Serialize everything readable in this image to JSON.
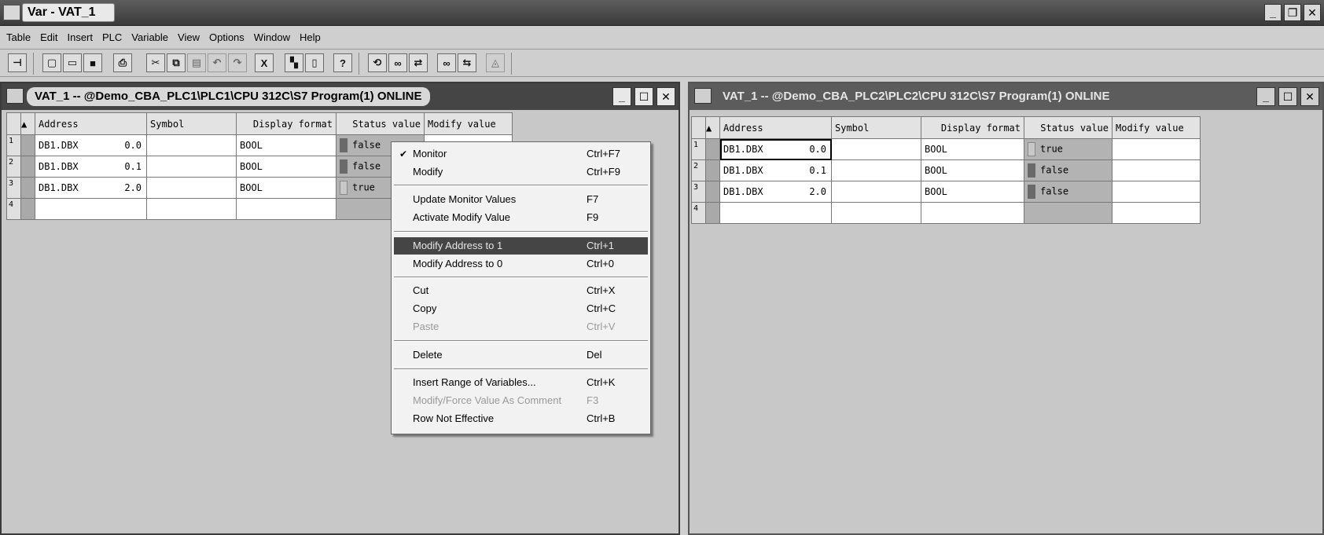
{
  "app": {
    "title": "Var - VAT_1",
    "window_buttons": [
      "_",
      "❐",
      "✕"
    ]
  },
  "menubar": [
    "Table",
    "Edit",
    "Insert",
    "PLC",
    "Variable",
    "View",
    "Options",
    "Window",
    "Help"
  ],
  "toolbar": {
    "glyphs": {
      "pin": "⊣",
      "new": "▢",
      "open": "▭",
      "save": "■",
      "print": "⎙",
      "cut": "✂",
      "copy": "⧉",
      "paste": "▤",
      "undo": "↶",
      "redo": "↷",
      "delete": "X",
      "online": "▚",
      "accessible": "▯",
      "help": "?",
      "monitor": "⟲",
      "monitor_var": "∞",
      "modify": "⇄",
      "update_monitor": "∞",
      "activate_modify": "⇆",
      "force": "◬"
    }
  },
  "left_window": {
    "title": "VAT_1 -- @Demo_CBA_PLC1\\PLC1\\CPU 312C\\S7 Program(1)  ONLINE",
    "headers": {
      "address": "Address",
      "symbol": "Symbol",
      "format": "Display format",
      "status": "Status value",
      "modify": "Modify value"
    },
    "rows": [
      {
        "num": "1",
        "addr": "DB1.DBX",
        "off": "0.0",
        "fmt": "BOOL",
        "status": "false",
        "led": "off"
      },
      {
        "num": "2",
        "addr": "DB1.DBX",
        "off": "0.1",
        "fmt": "BOOL",
        "status": "false",
        "led": "off"
      },
      {
        "num": "3",
        "addr": "DB1.DBX",
        "off": "2.0",
        "fmt": "BOOL",
        "status": "true",
        "led": "on"
      },
      {
        "num": "4",
        "addr": "",
        "off": "",
        "fmt": "",
        "status": "",
        "led": ""
      }
    ]
  },
  "right_window": {
    "title": "VAT_1 -- @Demo_CBA_PLC2\\PLC2\\CPU 312C\\S7 Program(1)  ONLINE",
    "headers": {
      "address": "Address",
      "symbol": "Symbol",
      "format": "Display format",
      "status": "Status value",
      "modify": "Modify value"
    },
    "rows": [
      {
        "num": "1",
        "addr": "DB1.DBX",
        "off": "0.0",
        "fmt": "BOOL",
        "status": "true",
        "led": "on"
      },
      {
        "num": "2",
        "addr": "DB1.DBX",
        "off": "0.1",
        "fmt": "BOOL",
        "status": "false",
        "led": "off"
      },
      {
        "num": "3",
        "addr": "DB1.DBX",
        "off": "2.0",
        "fmt": "BOOL",
        "status": "false",
        "led": "off"
      },
      {
        "num": "4",
        "addr": "",
        "off": "",
        "fmt": "",
        "status": "",
        "led": ""
      }
    ]
  },
  "context_menu": {
    "items": [
      {
        "label": "Monitor",
        "key": "Ctrl+F7",
        "checked": true
      },
      {
        "label": "Modify",
        "key": "Ctrl+F9"
      },
      {
        "label": "Update Monitor Values",
        "key": "F7"
      },
      {
        "label": "Activate Modify Value",
        "key": "F9"
      },
      {
        "label": "Modify Address to 1",
        "key": "Ctrl+1",
        "highlighted": true
      },
      {
        "label": "Modify Address to 0",
        "key": "Ctrl+0"
      },
      {
        "label": "Cut",
        "key": "Ctrl+X"
      },
      {
        "label": "Copy",
        "key": "Ctrl+C"
      },
      {
        "label": "Paste",
        "key": "Ctrl+V",
        "disabled": true
      },
      {
        "label": "Delete",
        "key": "Del"
      },
      {
        "label": "Insert Range of Variables...",
        "key": "Ctrl+K"
      },
      {
        "label": "Modify/Force Value As Comment",
        "key": "F3",
        "disabled": true
      },
      {
        "label": "Row Not Effective",
        "key": "Ctrl+B"
      }
    ],
    "check_mark": "✔"
  }
}
